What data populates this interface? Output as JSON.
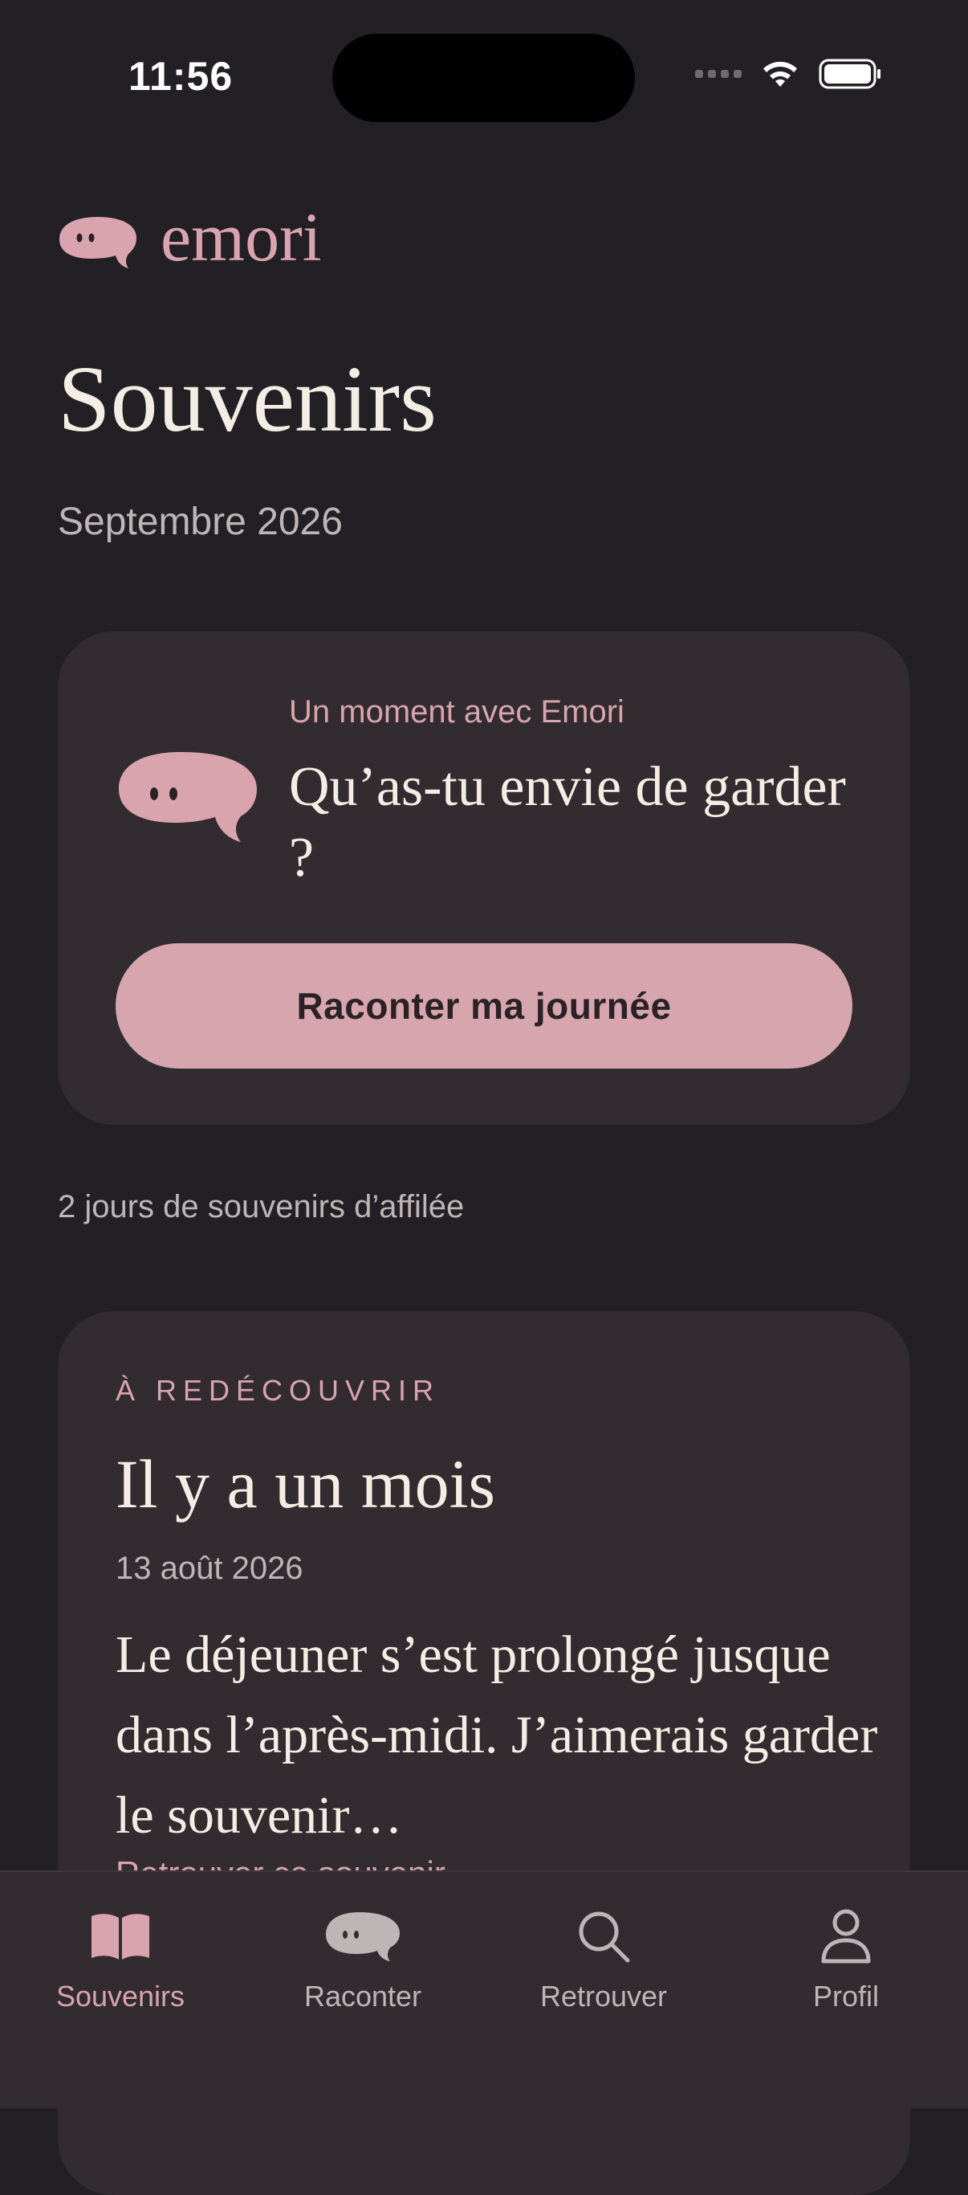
{
  "status_bar": {
    "time": "11:56"
  },
  "brand": {
    "name": "emori",
    "icon": "speech-bubble-face-icon"
  },
  "header": {
    "title": "Souvenirs",
    "subtitle": "Septembre 2026"
  },
  "prompt_card": {
    "eyebrow": "Un moment avec Emori",
    "question": "Qu’as-tu envie de garder ?",
    "button_label": "Raconter ma journée"
  },
  "streak": {
    "text": "2 jours de souvenirs d’affilée"
  },
  "memory_card": {
    "eyebrow": "À REDÉCOUVRIR",
    "title": "Il y a un mois",
    "date": "13 août 2026",
    "excerpt": "Le déjeuner s’est prolongé jusque dans l’après-midi. J’aimerais garder le souvenir…",
    "link": "Retrouver ce souvenir →"
  },
  "tabs": [
    {
      "label": "Souvenirs",
      "icon": "open-book-icon",
      "active": true
    },
    {
      "label": "Raconter",
      "icon": "speech-bubble-face-icon",
      "active": false
    },
    {
      "label": "Retrouver",
      "icon": "search-icon",
      "active": false
    },
    {
      "label": "Profil",
      "icon": "person-icon",
      "active": false
    }
  ],
  "colors": {
    "background": "#232025",
    "card": "#322C31",
    "accent": "#D9A4AD",
    "button": "#D6A5AE",
    "text_primary": "#F3EDE3",
    "text_secondary": "#BDB6B6"
  }
}
